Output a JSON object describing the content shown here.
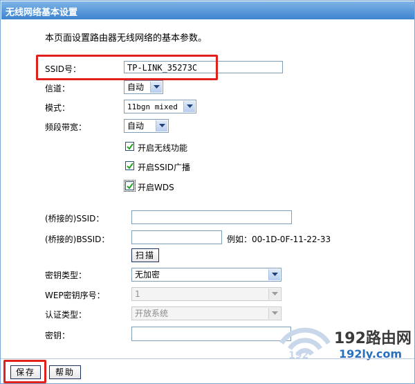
{
  "window": {
    "title": "无线网络基本设置"
  },
  "description": "本页面设置路由器无线网络的基本参数。",
  "fields": {
    "ssid": {
      "label": "SSID号：",
      "value": "TP-LINK_35273C"
    },
    "channel": {
      "label": "信道：",
      "value": "自动"
    },
    "mode": {
      "label": "模式：",
      "value": "11bgn mixed"
    },
    "bandwidth": {
      "label": "频段带宽：",
      "value": "自动"
    }
  },
  "checkboxes": [
    {
      "label": "开启无线功能",
      "checked": true
    },
    {
      "label": "开启SSID广播",
      "checked": true
    },
    {
      "label": "开启WDS",
      "checked": true
    }
  ],
  "wds": {
    "bridged_ssid_label": "(桥接的)SSID：",
    "bridged_ssid_value": "",
    "bridged_bssid_label": "(桥接的)BSSID：",
    "bridged_bssid_value": "",
    "example": "例如：00-1D-0F-11-22-33",
    "scan_button": "扫描",
    "key_type_label": "密钥类型：",
    "key_type_value": "无加密",
    "wep_index_label": "WEP密钥序号：",
    "wep_index_value": "1",
    "auth_type_label": "认证类型：",
    "auth_type_value": "开放系统",
    "key_label": "密钥：",
    "key_value": ""
  },
  "buttons": {
    "save": "保存",
    "help": "帮助"
  },
  "watermark": {
    "brand": "192路由网",
    "left_num": "192",
    "site": "192ly.com"
  },
  "colors": {
    "title_bar": "#3d83cf",
    "highlight": "#e0201a",
    "watermark": "#2a6fbe"
  }
}
